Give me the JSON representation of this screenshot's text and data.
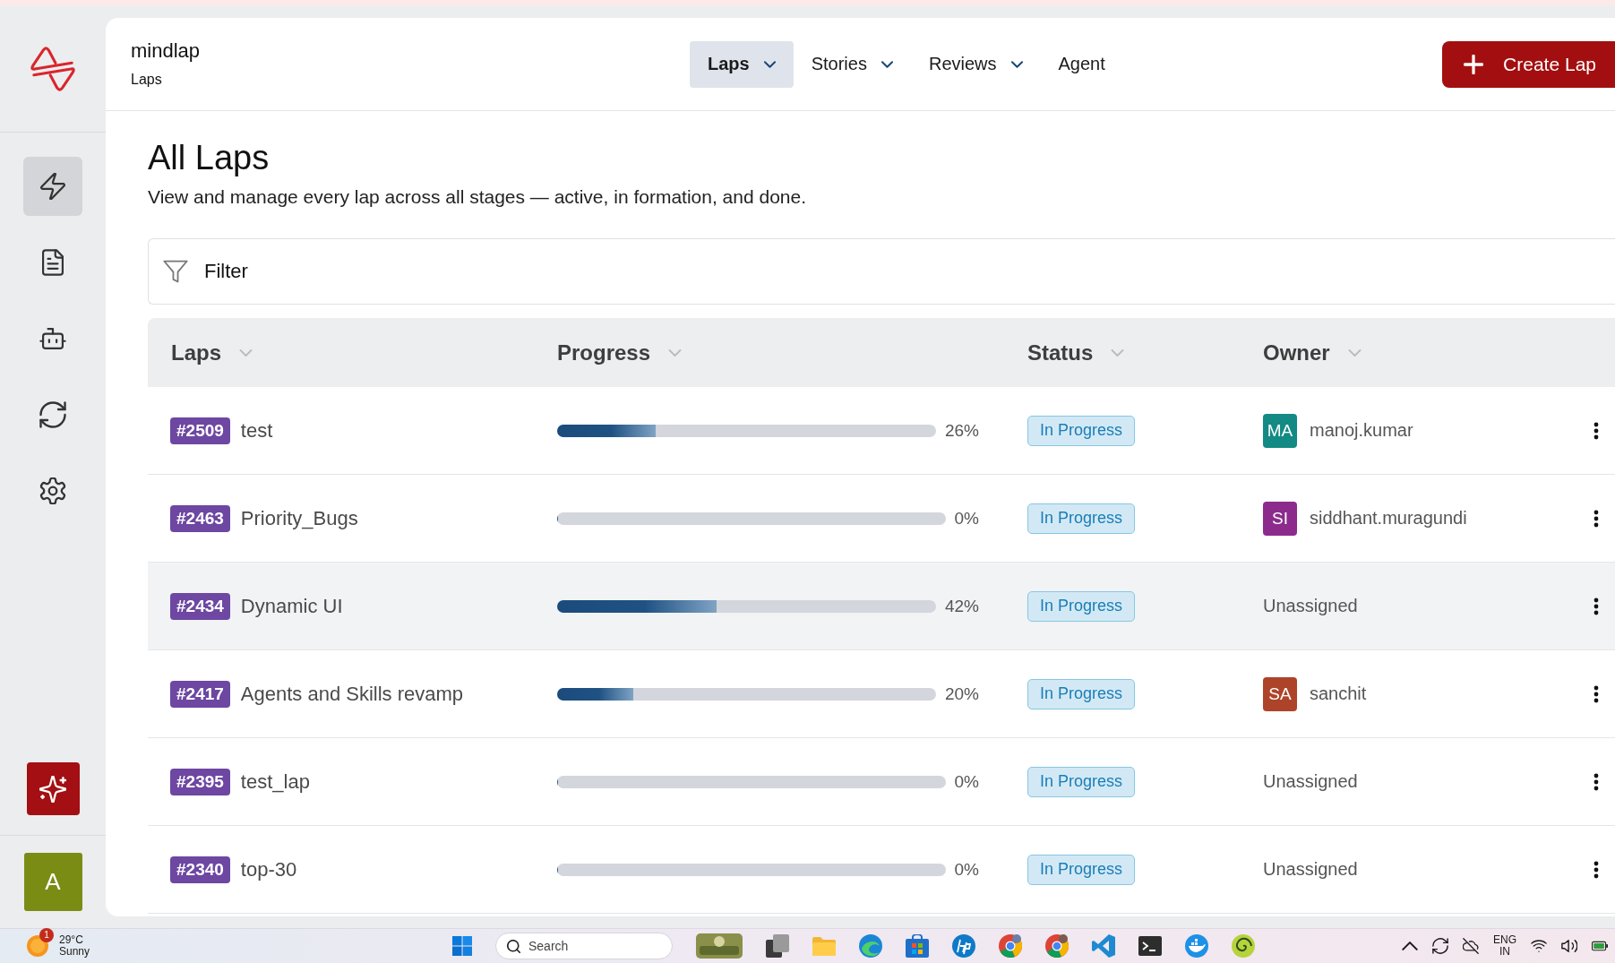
{
  "app": {
    "name": "mindlap",
    "section": "Laps"
  },
  "nav": [
    {
      "label": "Laps",
      "selected": true,
      "has_menu": true
    },
    {
      "label": "Stories",
      "selected": false,
      "has_menu": true
    },
    {
      "label": "Reviews",
      "selected": false,
      "has_menu": true
    },
    {
      "label": "Agent",
      "selected": false,
      "has_menu": false
    }
  ],
  "create_button": {
    "label": "Create Lap"
  },
  "sidebar": {
    "items": [
      {
        "selected": true
      },
      {
        "selected": false
      },
      {
        "selected": false
      },
      {
        "selected": false
      },
      {
        "selected": false
      }
    ],
    "user_initial": "A"
  },
  "page": {
    "title": "All Laps",
    "subtitle": "View and manage every lap across all stages — active, in formation, and done."
  },
  "filter": {
    "label": "Filter"
  },
  "table": {
    "columns": [
      "Laps",
      "Progress",
      "Status",
      "Owner"
    ],
    "rows": [
      {
        "id": "#2509",
        "name": "test",
        "level": 0.26,
        "reading": "26%",
        "status": "In Progress",
        "hovered": false,
        "owner": {
          "kind": "user",
          "initials": "MA",
          "name": "manoj.kumar",
          "color": "#138a84"
        }
      },
      {
        "id": "#2463",
        "name": "Priority_Bugs",
        "level": 0,
        "reading": "0%",
        "status": "In Progress",
        "hovered": false,
        "owner": {
          "kind": "user",
          "initials": "SI",
          "name": "siddhant.muragundi",
          "color": "#8c2b8c"
        }
      },
      {
        "id": "#2434",
        "name": "Dynamic UI",
        "level": 0.42,
        "reading": "42%",
        "status": "In Progress",
        "hovered": true,
        "owner": {
          "kind": "unassigned",
          "name": "Unassigned"
        }
      },
      {
        "id": "#2417",
        "name": "Agents and Skills revamp",
        "level": 0.2,
        "reading": "20%",
        "status": "In Progress",
        "hovered": false,
        "owner": {
          "kind": "user",
          "initials": "SA",
          "name": "sanchit",
          "color": "#ad442a"
        }
      },
      {
        "id": "#2395",
        "name": "test_lap",
        "level": 0,
        "reading": "0%",
        "status": "In Progress",
        "hovered": false,
        "owner": {
          "kind": "unassigned",
          "name": "Unassigned"
        }
      },
      {
        "id": "#2340",
        "name": "top-30",
        "level": 0,
        "reading": "0%",
        "status": "In Progress",
        "hovered": false,
        "owner": {
          "kind": "unassigned",
          "name": "Unassigned"
        }
      }
    ]
  },
  "taskbar": {
    "weather": {
      "alerts": "1",
      "temperature": "29°C",
      "condition": "Sunny"
    },
    "search": {
      "placeholder": "Search"
    },
    "language": {
      "lang": "ENG",
      "region": "IN"
    }
  }
}
